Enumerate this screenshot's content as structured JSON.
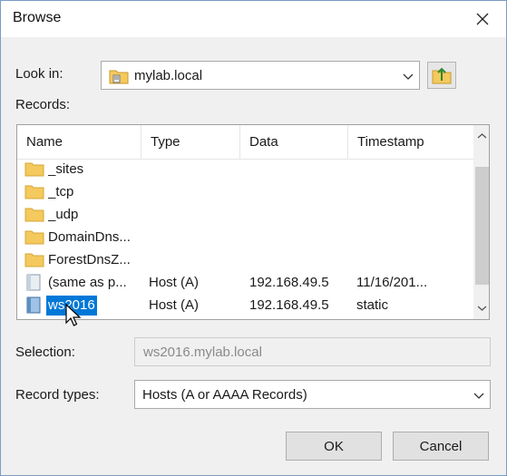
{
  "window": {
    "title": "Browse"
  },
  "look_in": {
    "label": "Look in:",
    "value": "mylab.local",
    "folder_icon": "folder-server-icon"
  },
  "records": {
    "label": "Records:",
    "columns": [
      "Name",
      "Type",
      "Data",
      "Timestamp"
    ],
    "rows": [
      {
        "name": "_sites",
        "type": "",
        "data": "",
        "timestamp": "",
        "icon": "folder-icon",
        "selected": false
      },
      {
        "name": "_tcp",
        "type": "",
        "data": "",
        "timestamp": "",
        "icon": "folder-icon",
        "selected": false
      },
      {
        "name": "_udp",
        "type": "",
        "data": "",
        "timestamp": "",
        "icon": "folder-icon",
        "selected": false
      },
      {
        "name": "DomainDns...",
        "type": "",
        "data": "",
        "timestamp": "",
        "icon": "folder-icon",
        "selected": false
      },
      {
        "name": "ForestDnsZ...",
        "type": "",
        "data": "",
        "timestamp": "",
        "icon": "folder-icon",
        "selected": false
      },
      {
        "name": "(same as p...",
        "type": "Host (A)",
        "data": "192.168.49.5",
        "timestamp": "11/16/201...",
        "icon": "record-icon",
        "selected": false
      },
      {
        "name": "ws2016",
        "type": "Host (A)",
        "data": "192.168.49.5",
        "timestamp": "static",
        "icon": "record-icon",
        "selected": true
      }
    ]
  },
  "selection": {
    "label": "Selection:",
    "value": "ws2016.mylab.local"
  },
  "record_types": {
    "label": "Record types:",
    "value": "Hosts (A or AAAA Records)"
  },
  "buttons": {
    "ok": "OK",
    "cancel": "Cancel"
  },
  "colors": {
    "accent": "#0078d7",
    "folder": "#f4c95d",
    "dialog_bg": "#f0f0f0"
  }
}
